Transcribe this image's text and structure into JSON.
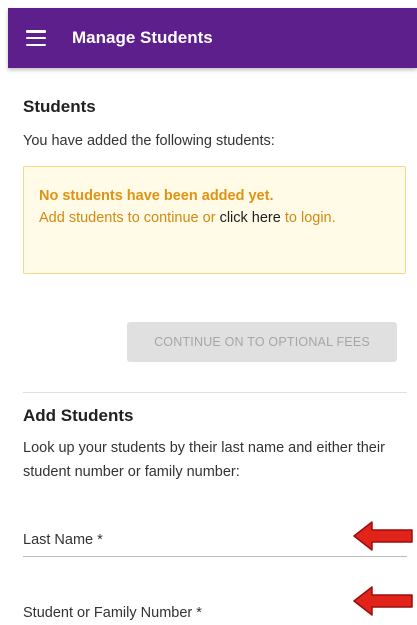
{
  "appbar": {
    "menu_icon": "hamburger-menu-icon",
    "title": "Manage Students",
    "color": "#5c1f8c"
  },
  "students": {
    "title": "Students",
    "intro": "You have added the following students:",
    "notice": {
      "strong": "No students have been added yet.",
      "text_before": "Add students to continue or ",
      "link_text": "click here",
      "text_after": " to login."
    },
    "continue_button": "CONTINUE ON TO OPTIONAL FEES"
  },
  "add_students": {
    "title": "Add Students",
    "lookup_text": "Look up your students by their last name and either their student number or family number:",
    "fields": [
      {
        "label": "Last Name *",
        "value": ""
      },
      {
        "label": "Student or Family Number *",
        "value": ""
      }
    ]
  },
  "annotations": {
    "arrow_color": "#e2231a",
    "arrow_icon": "red-arrow-left-icon"
  }
}
